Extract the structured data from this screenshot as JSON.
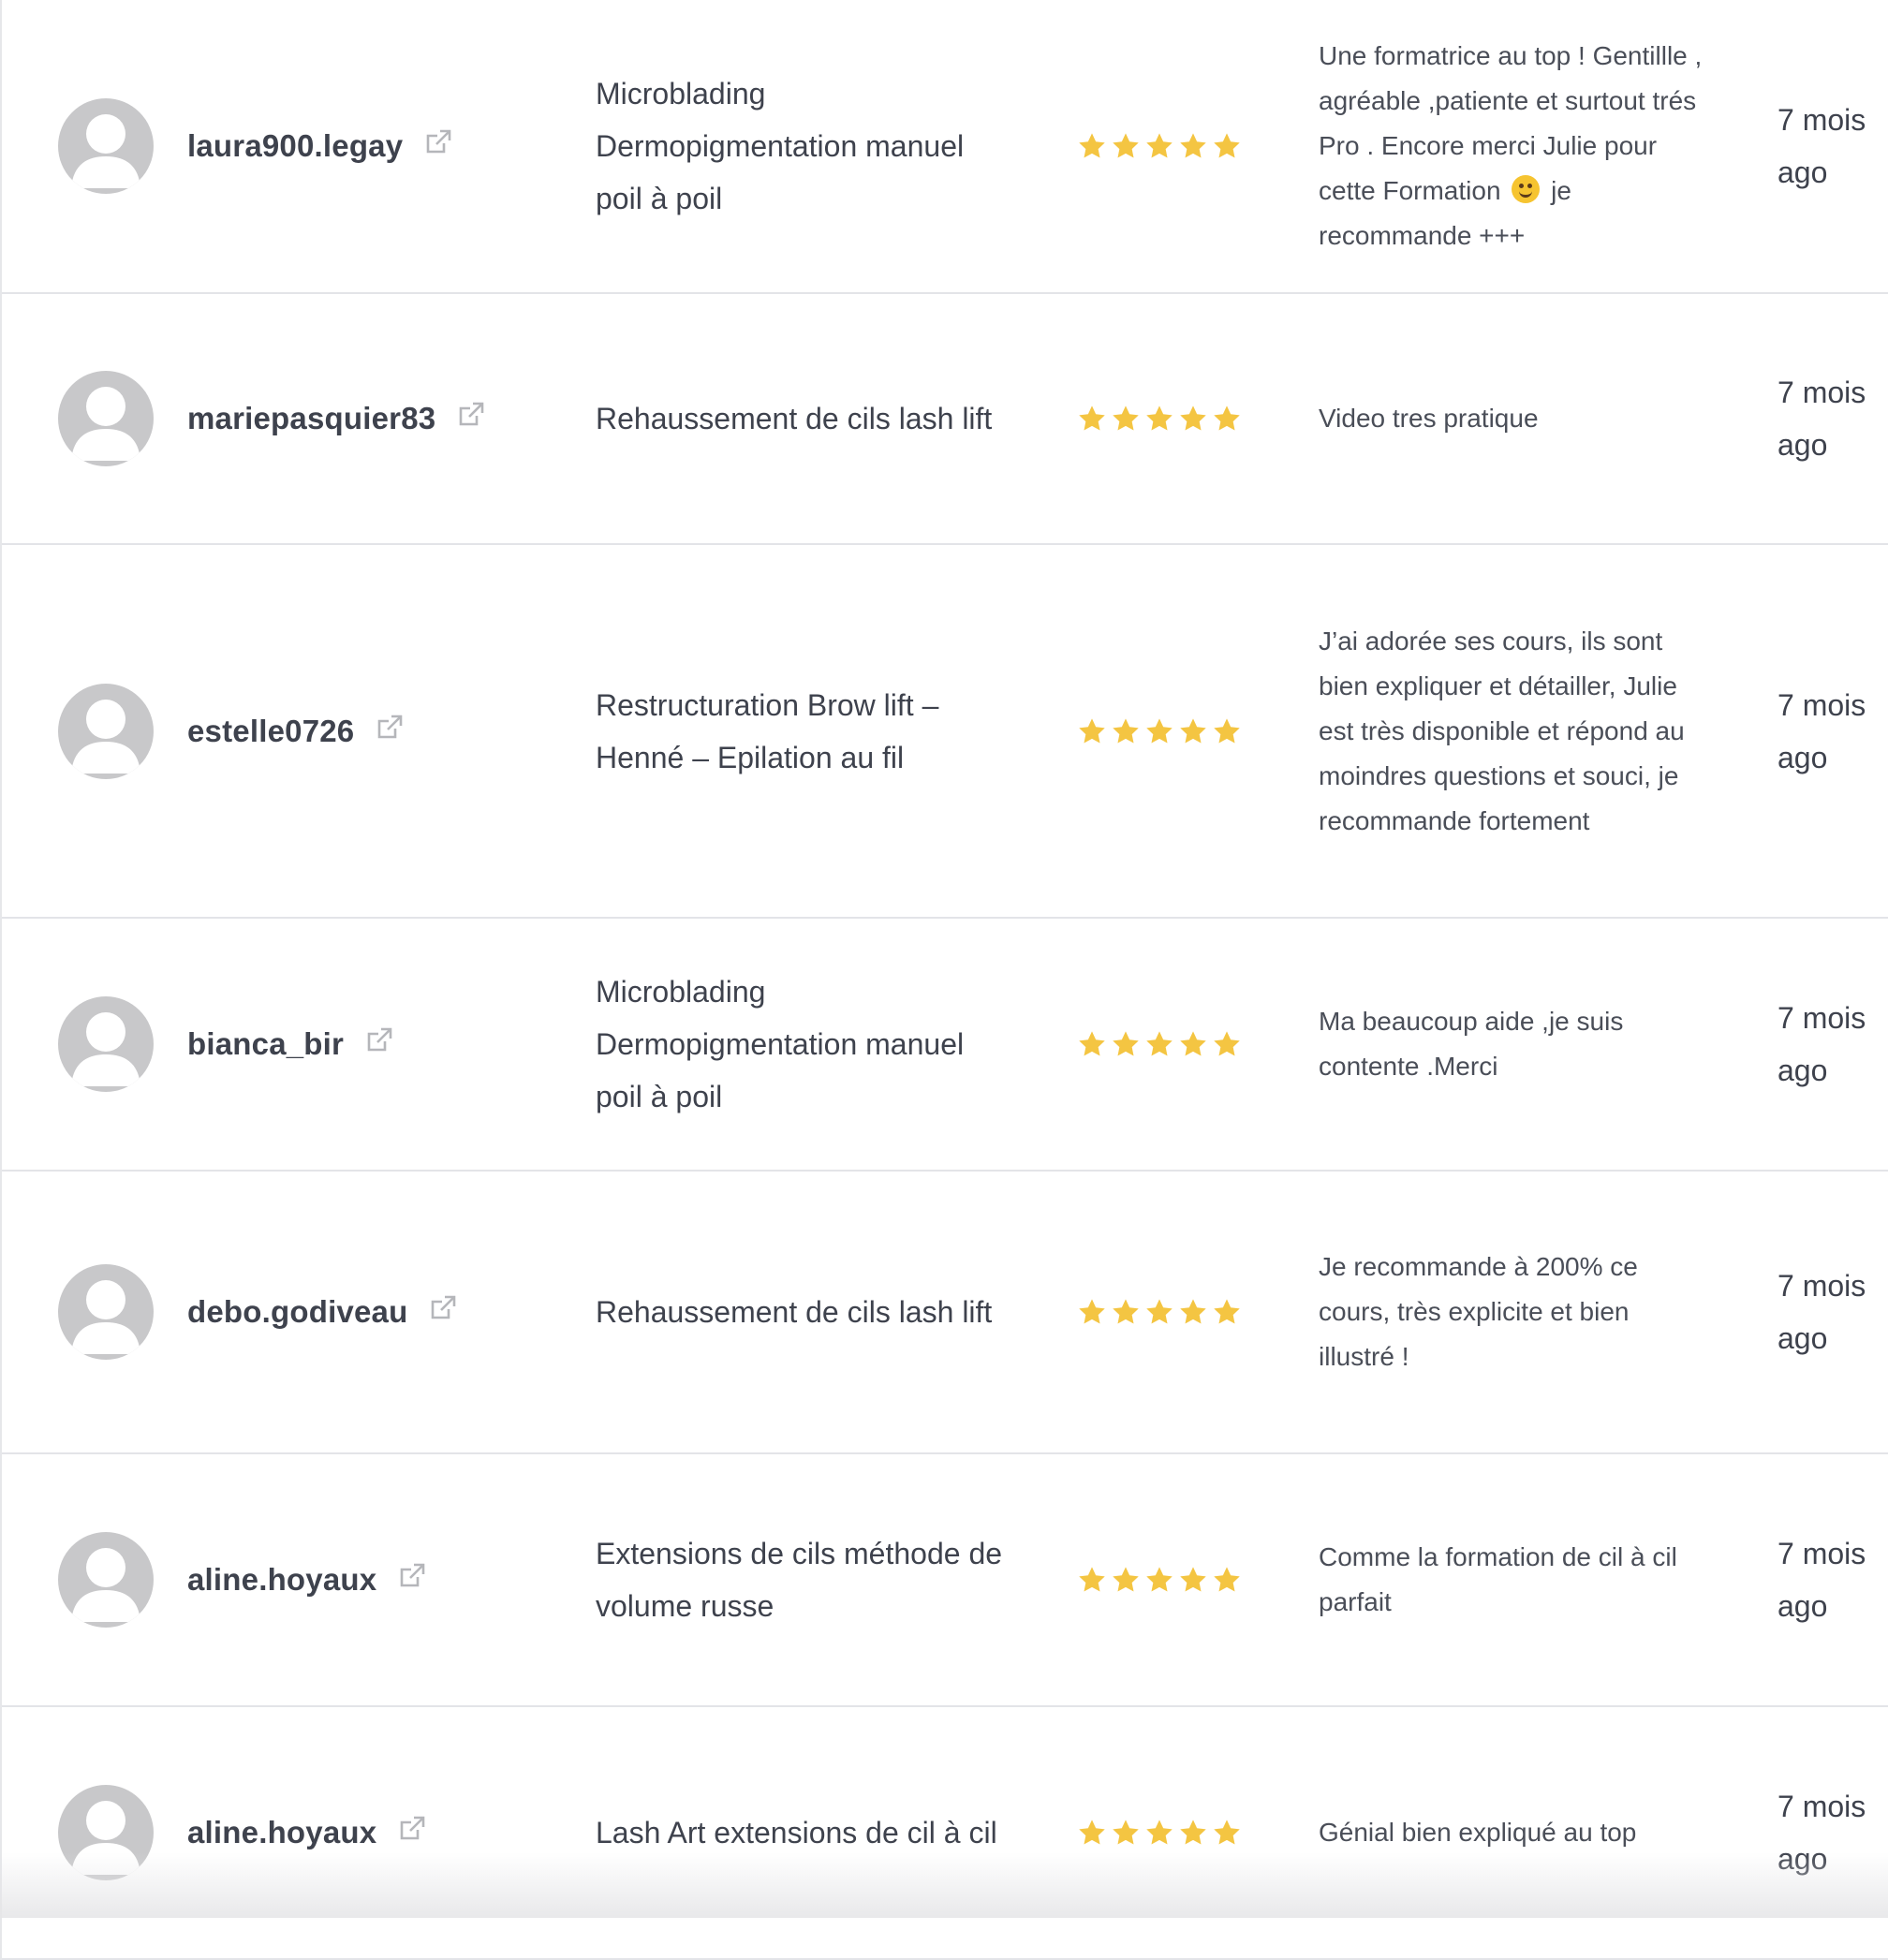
{
  "colors": {
    "star": "#f4c542",
    "avatar_bg": "#c8c8ca",
    "divider": "#e3e4e8",
    "text": "#3e424d"
  },
  "icons": {
    "avatar": "default-user-avatar",
    "external_link": "external-link-icon",
    "star": "star-icon"
  },
  "reviews": [
    {
      "username": "laura900.legay",
      "course": "Microblading Dermopigmentation manuel poil à poil",
      "rating": 5,
      "comment_before_emoji": "Une formatrice au top ! Gentillle , agréable ,patiente et surtout trés Pro . Encore merci Julie pour cette Formation",
      "comment_after_emoji": " je recommande +++",
      "time": "7 mois ago"
    },
    {
      "username": "mariepasquier83",
      "course": "Rehaussement de cils lash lift",
      "rating": 5,
      "comment": "Video tres pratique",
      "time": "7 mois ago"
    },
    {
      "username": "estelle0726",
      "course": "Restructuration Brow lift – Henné – Epilation au fil",
      "rating": 5,
      "comment": "J’ai adorée ses cours, ils sont bien expliquer et détailler, Julie est très disponible et répond au moindres questions et souci, je recommande fortement",
      "time": "7 mois ago"
    },
    {
      "username": "bianca_bir",
      "course": "Microblading Dermopigmentation manuel poil à poil",
      "rating": 5,
      "comment": "Ma beaucoup aide ,je suis contente .Merci",
      "time": "7 mois ago"
    },
    {
      "username": "debo.godiveau",
      "course": "Rehaussement de cils lash lift",
      "rating": 5,
      "comment": "Je recommande à 200% ce cours, très explicite et bien illustré !",
      "time": "7 mois ago"
    },
    {
      "username": "aline.hoyaux",
      "course": "Extensions de cils méthode de volume russe",
      "rating": 5,
      "comment": "Comme la formation de cil à cil parfait",
      "time": "7 mois ago"
    },
    {
      "username": "aline.hoyaux",
      "course": "Lash Art extensions de cil à cil",
      "rating": 5,
      "comment": "Génial bien expliqué au top",
      "time": "7 mois ago"
    }
  ]
}
